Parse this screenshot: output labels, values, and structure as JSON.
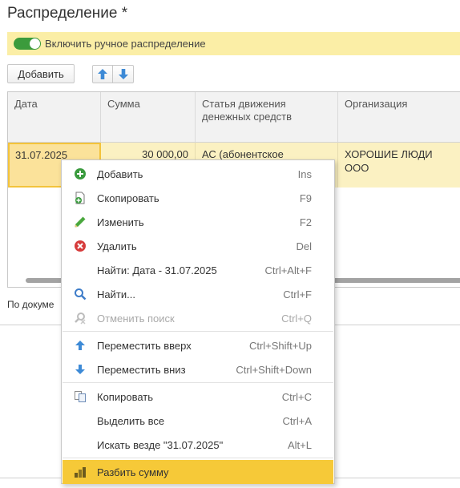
{
  "form": {
    "title": "Распределение *",
    "toggle_label": "Включить ручное распределение",
    "add_button": "Добавить"
  },
  "table": {
    "columns": [
      "Дата",
      "Сумма",
      "Статья движения\nденежных средств",
      "Организация"
    ],
    "row": {
      "date": "31.07.2025",
      "amount": "30 000,00",
      "article": "АС (абонентское",
      "organization": "ХОРОШИЕ ЛЮДИ\nООО"
    }
  },
  "footer": {
    "text": "По докуме"
  },
  "context_menu": {
    "items": [
      {
        "label": "Добавить",
        "shortcut": "Ins",
        "icon": "plus-circle-icon",
        "disabled": false
      },
      {
        "label": "Скопировать",
        "shortcut": "F9",
        "icon": "copy-document-icon",
        "disabled": false
      },
      {
        "label": "Изменить",
        "shortcut": "F2",
        "icon": "pencil-icon",
        "disabled": false
      },
      {
        "label": "Удалить",
        "shortcut": "Del",
        "icon": "delete-x-icon",
        "disabled": false
      },
      {
        "label": "Найти: Дата - 31.07.2025",
        "shortcut": "Ctrl+Alt+F",
        "icon": "",
        "disabled": false
      },
      {
        "label": "Найти...",
        "shortcut": "Ctrl+F",
        "icon": "magnifier-icon",
        "disabled": false
      },
      {
        "label": "Отменить поиск",
        "shortcut": "Ctrl+Q",
        "icon": "cancel-search-icon",
        "disabled": true
      },
      {
        "label": "Переместить вверх",
        "shortcut": "Ctrl+Shift+Up",
        "icon": "arrow-up-icon",
        "disabled": false
      },
      {
        "label": "Переместить вниз",
        "shortcut": "Ctrl+Shift+Down",
        "icon": "arrow-down-icon",
        "disabled": false
      },
      {
        "label": "Копировать",
        "shortcut": "Ctrl+C",
        "icon": "clipboard-copy-icon",
        "disabled": false
      },
      {
        "label": "Выделить все",
        "shortcut": "Ctrl+A",
        "icon": "",
        "disabled": false
      },
      {
        "label": "Искать везде \"31.07.2025\"",
        "shortcut": "Alt+L",
        "icon": "",
        "disabled": false
      },
      {
        "label": "Разбить сумму",
        "shortcut": "",
        "icon": "split-amount-icon",
        "disabled": false,
        "highlighted": true
      }
    ]
  },
  "colors": {
    "toggle_bar": "#fbeea6",
    "toggle_on": "#3b9b3c",
    "selected_row": "#fbf1c2",
    "selected_cell_border": "#f3c33b",
    "menu_highlight": "#f6c938",
    "arrow_blue": "#3d8ad6"
  }
}
